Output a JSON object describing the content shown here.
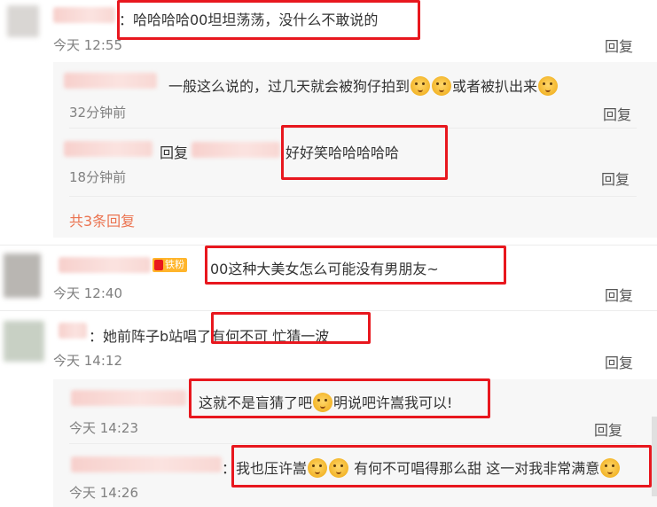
{
  "comments": [
    {
      "text": "：哈哈哈哈00坦坦荡荡，没什么不敢说的",
      "time": "今天 12:55",
      "reply_label": "回复",
      "replies": [
        {
          "text": "一般这么说的，过几天就会被狗仔拍到",
          "text_tail": "或者被扒出来",
          "time": "32分钟前",
          "reply_label": "回复"
        },
        {
          "prefix": "回复",
          "text": "好好笑哈哈哈哈哈",
          "time": "18分钟前",
          "reply_label": "回复"
        }
      ],
      "more_replies": "共3条回复"
    },
    {
      "badge": "铁粉",
      "text": "00这种大美女怎么可能没有男朋友~",
      "time": "今天 12:40",
      "reply_label": "回复"
    },
    {
      "text": "：她前阵子b站唱了有何不可 忙猜一波",
      "time": "今天 14:12",
      "reply_label": "回复",
      "replies": [
        {
          "text": "这就不是盲猜了吧",
          "text_tail": "明说吧许嵩我可以!",
          "time": "今天 14:23",
          "reply_label": "回复"
        },
        {
          "text": "：我也压许嵩",
          "text_tail": "有何不可唱得那么甜 这一对我非常满意",
          "time": "今天 14:26",
          "reply_label": "回复"
        }
      ]
    }
  ],
  "icons": {
    "emoji": "doge-emoji-icon",
    "shocked": "shocked-emoji-icon",
    "badge": "fan-badge-icon"
  },
  "colors": {
    "highlight_box": "#e8171e",
    "link_orange": "#eb7350",
    "reply_bg": "#f7f7f7",
    "time_gray": "#808080"
  }
}
